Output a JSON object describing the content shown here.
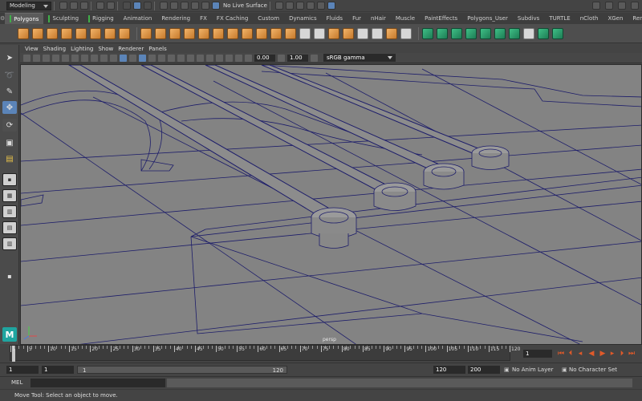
{
  "status_line": {
    "mode": "Modeling",
    "live_surface": "No Live Surface"
  },
  "shelf_tabs": [
    "Polygons",
    "Sculpting",
    "Rigging",
    "Animation",
    "Rendering",
    "FX",
    "FX Caching",
    "Custom",
    "Dynamics",
    "Fluids",
    "Fur",
    "nHair",
    "Muscle",
    "PaintEffects",
    "Polygons_User",
    "Subdivs",
    "TURTLE",
    "nCloth",
    "XGen",
    "RenderMan"
  ],
  "active_tab": "Polygons",
  "panel_menu": [
    "View",
    "Shading",
    "Lighting",
    "Show",
    "Renderer",
    "Panels"
  ],
  "panel_toolbar": {
    "exposure": "0.00",
    "gamma": "1.00",
    "color_space": "sRGB gamma"
  },
  "viewport": {
    "camera_label": "persp"
  },
  "time_slider": {
    "tick_labels": [
      "1",
      "5",
      "10",
      "15",
      "20",
      "25",
      "30",
      "35",
      "40",
      "45",
      "50",
      "55",
      "60",
      "65",
      "70",
      "75",
      "80",
      "85",
      "90",
      "95",
      "100",
      "105",
      "110",
      "115",
      "120"
    ],
    "current_frame": "1"
  },
  "range_slider": {
    "start": "1",
    "playback_start": "1",
    "bar_start": "1",
    "bar_end": "120",
    "playback_end": "120",
    "end": "200",
    "anim_layer": "No Anim Layer",
    "character_set": "No Character Set"
  },
  "command_line": {
    "label": "MEL"
  },
  "help_line": {
    "text": "Move Tool: Select an object to move."
  },
  "icons": {
    "select_tool": "arrow-cursor-icon",
    "lasso_tool": "lasso-icon",
    "paint_tool": "brush-icon",
    "move_tool": "move-icon",
    "rotate_tool": "rotate-icon",
    "scale_tool": "scale-icon",
    "logo": "maya-logo-icon"
  },
  "colors": {
    "accent": "#5b84b8",
    "wireframe": "#1d1d6a",
    "viewport_bg": "#838383"
  }
}
